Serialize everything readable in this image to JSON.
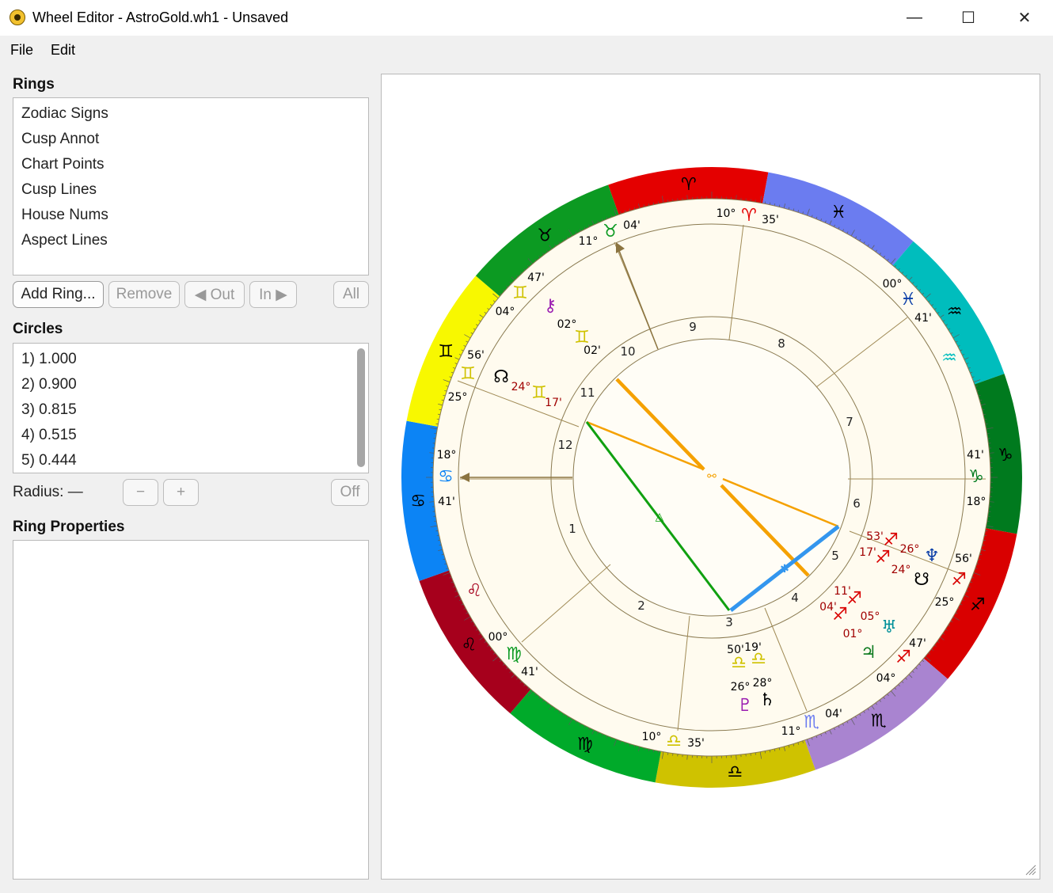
{
  "window": {
    "title": "Wheel Editor - AstroGold.wh1 - Unsaved",
    "minimize": "—",
    "maximize": "☐",
    "close": "✕"
  },
  "menu": {
    "file": "File",
    "edit": "Edit"
  },
  "rings": {
    "label": "Rings",
    "items": [
      "Zodiac Signs",
      "Cusp Annot",
      "Chart Points",
      "Cusp Lines",
      "House Nums",
      "Aspect Lines"
    ],
    "buttons": {
      "add": "Add Ring...",
      "remove": "Remove",
      "out": "◀ Out",
      "in": "In ▶",
      "all": "All"
    }
  },
  "circles": {
    "label": "Circles",
    "items": [
      "1) 1.000",
      "2) 0.900",
      "3) 0.815",
      "4) 0.515",
      "5) 0.444"
    ]
  },
  "radius": {
    "label": "Radius:",
    "value": "—",
    "minus": "−",
    "plus": "+",
    "off": "Off"
  },
  "ring_properties": {
    "label": "Ring Properties"
  },
  "wheel": {
    "sign_colors": [
      "#e40000",
      "#6b7cf0",
      "#00bdbd",
      "#007a1e",
      "#d90000",
      "#a984d0",
      "#cfc200",
      "#00aa2a",
      "#a6001c",
      "#0c84f5",
      "#f8f800",
      "#0c9a22"
    ],
    "house_numbers": [
      "1",
      "2",
      "3",
      "4",
      "5",
      "6",
      "7",
      "8",
      "9",
      "10",
      "11",
      "12"
    ],
    "annotations": [
      {
        "t": "10°",
        "c": "#000"
      },
      {
        "t": "35'",
        "c": "#000"
      },
      {
        "t": "04'",
        "c": "#000"
      },
      {
        "t": "11°",
        "c": "#000"
      },
      {
        "t": "00°",
        "c": "#000"
      },
      {
        "t": "41'",
        "c": "#000"
      },
      {
        "t": "47'",
        "c": "#000"
      },
      {
        "t": "04°",
        "c": "#000"
      },
      {
        "t": "02°",
        "c": "#000"
      },
      {
        "t": "02'",
        "c": "#000"
      },
      {
        "t": "56'",
        "c": "#000"
      },
      {
        "t": "25°",
        "c": "#000"
      },
      {
        "t": "24°",
        "c": "#a00000"
      },
      {
        "t": "17'",
        "c": "#a00000"
      },
      {
        "t": "18°",
        "c": "#000"
      },
      {
        "t": "41'",
        "c": "#000"
      },
      {
        "t": "41'",
        "c": "#000"
      },
      {
        "t": "18°",
        "c": "#000"
      },
      {
        "t": "53'",
        "c": "#a00000"
      },
      {
        "t": "17'",
        "c": "#a00000"
      },
      {
        "t": "26°",
        "c": "#a00000"
      },
      {
        "t": "24°",
        "c": "#a00000"
      },
      {
        "t": "56'",
        "c": "#000"
      },
      {
        "t": "25°",
        "c": "#000"
      },
      {
        "t": "11'",
        "c": "#a00000"
      },
      {
        "t": "04'",
        "c": "#a00000"
      },
      {
        "t": "05°",
        "c": "#a00000"
      },
      {
        "t": "01°",
        "c": "#a00000"
      },
      {
        "t": "47'",
        "c": "#000"
      },
      {
        "t": "04°",
        "c": "#000"
      },
      {
        "t": "50'",
        "c": "#000"
      },
      {
        "t": "19'",
        "c": "#000"
      },
      {
        "t": "26°",
        "c": "#000"
      },
      {
        "t": "28°",
        "c": "#000"
      },
      {
        "t": "04'",
        "c": "#000"
      },
      {
        "t": "11°",
        "c": "#000"
      },
      {
        "t": "10°",
        "c": "#000"
      },
      {
        "t": "35'",
        "c": "#000"
      },
      {
        "t": "00°",
        "c": "#000"
      },
      {
        "t": "41'",
        "c": "#000"
      }
    ]
  }
}
